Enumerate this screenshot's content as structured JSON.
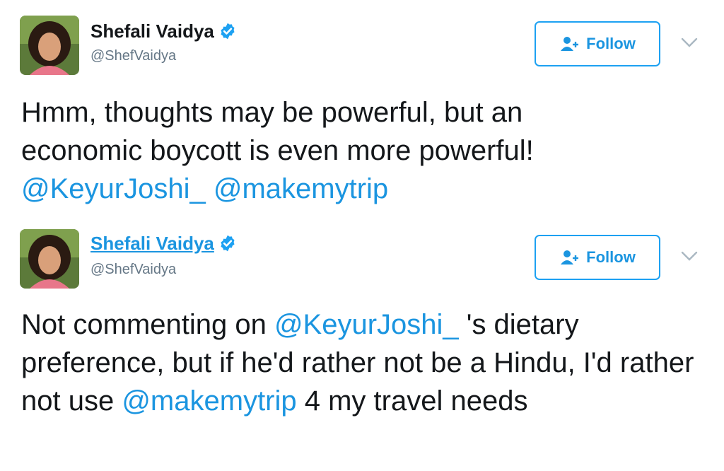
{
  "tweets": [
    {
      "author": {
        "name": "Shefali Vaidya",
        "handle": "@ShefVaidya",
        "verified": true
      },
      "follow_label": "Follow",
      "text": {
        "line1": "Hmm, thoughts may be powerful, but an",
        "line2": "economic boycott is even more powerful!",
        "mention1": "@KeyurJoshi_",
        "mention2": "@makemytrip"
      }
    },
    {
      "author": {
        "name": "Shefali Vaidya",
        "handle": "@ShefVaidya",
        "verified": true
      },
      "follow_label": "Follow",
      "text": {
        "part1": "Not commenting on ",
        "mention1": "@KeyurJoshi_",
        "part2": " 's dietary preference, but if he'd rather not be a Hindu, I'd rather not use ",
        "mention2": "@makemytrip",
        "part3": " 4  my travel needs"
      }
    }
  ],
  "colors": {
    "link": "#1b95e0",
    "border": "#1da1f2",
    "muted": "#657786",
    "text": "#14171a"
  },
  "icons": {
    "verified": "verified-badge-icon",
    "follow": "add-user-icon",
    "caret": "chevron-down-icon"
  }
}
